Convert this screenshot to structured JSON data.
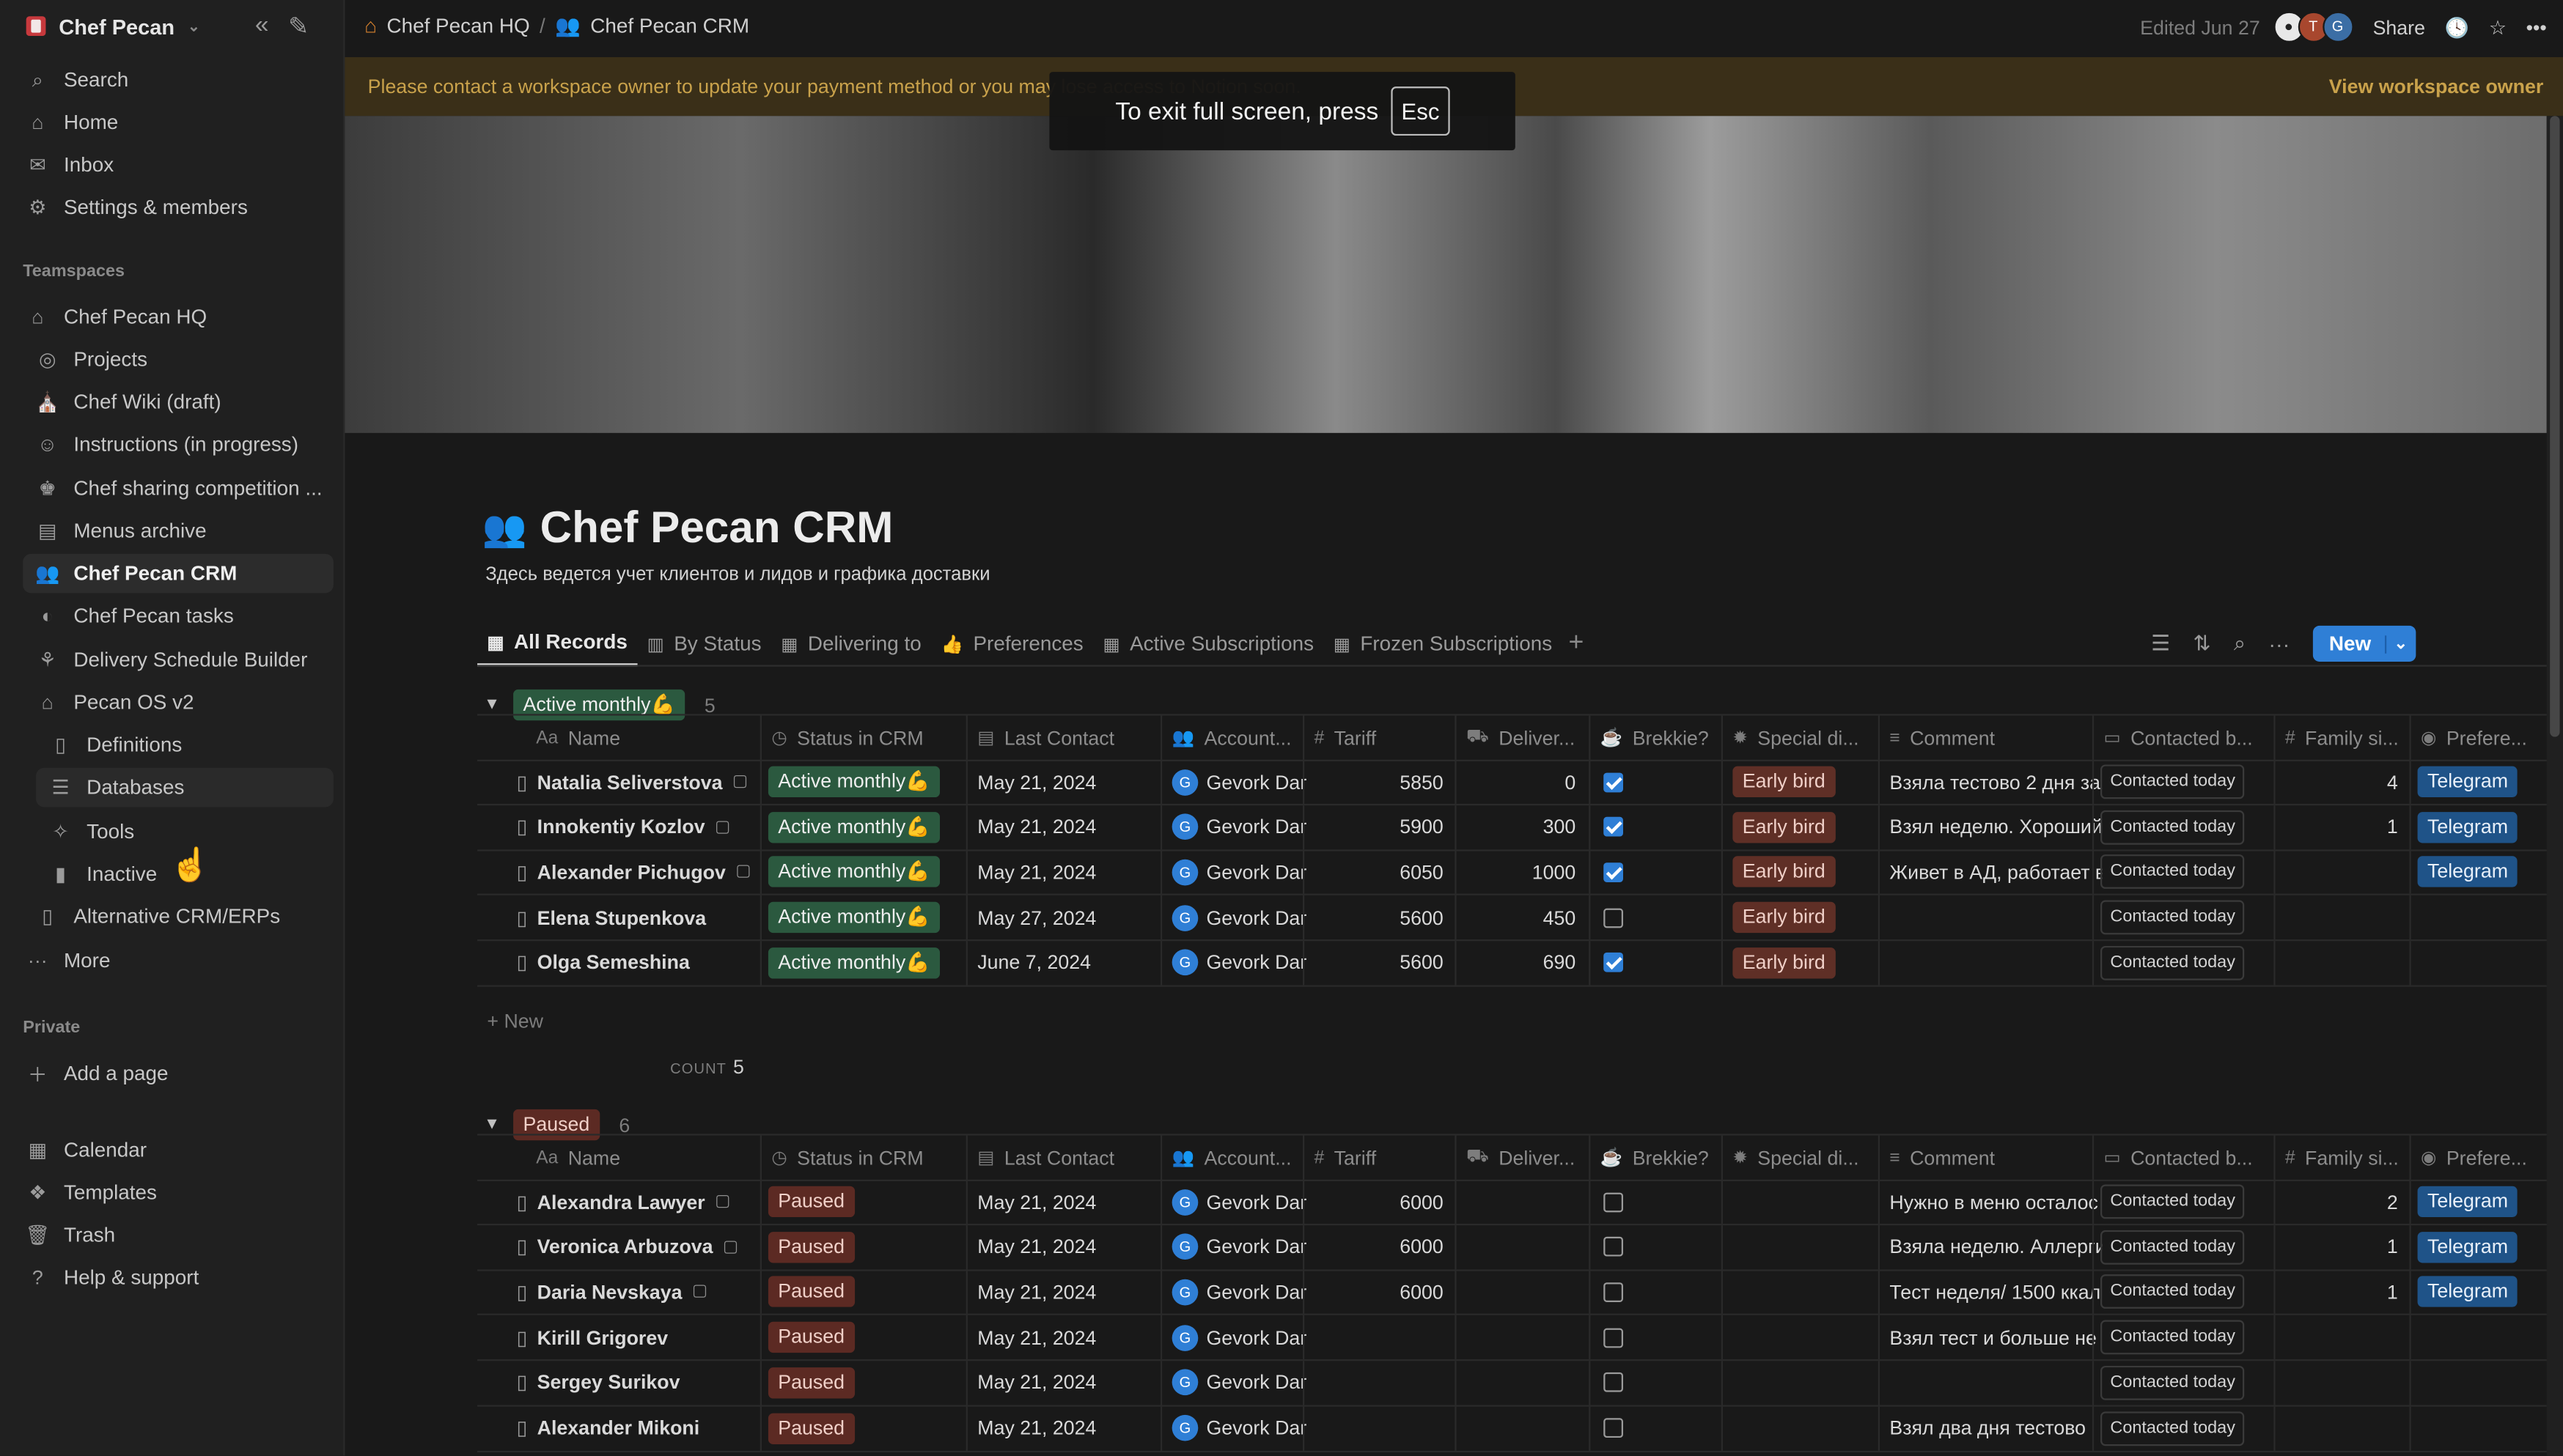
{
  "sidebar": {
    "workspace": "Chef Pecan",
    "top_items": [
      {
        "label": "Search",
        "icon": "search-icon"
      },
      {
        "label": "Home",
        "icon": "home-icon"
      },
      {
        "label": "Inbox",
        "icon": "inbox-icon"
      },
      {
        "label": "Settings & members",
        "icon": "gear-icon"
      }
    ],
    "teamspaces_label": "Teamspaces",
    "teamspace_items": [
      {
        "label": "Chef Pecan HQ",
        "icon": "home-icon"
      },
      {
        "label": "Projects",
        "icon": "target-icon"
      },
      {
        "label": "Chef Wiki (draft)",
        "icon": "wiki-icon"
      },
      {
        "label": "Instructions (in progress)",
        "icon": "emoji-icon"
      },
      {
        "label": "Chef sharing competition ...",
        "icon": "chef-icon"
      },
      {
        "label": "Menus archive",
        "icon": "archive-icon"
      },
      {
        "label": "Chef Pecan CRM",
        "icon": "people-icon"
      },
      {
        "label": "Chef Pecan tasks",
        "icon": "tasks-icon"
      },
      {
        "label": "Delivery Schedule Builder",
        "icon": "bike-icon"
      },
      {
        "label": "Pecan OS v2",
        "icon": "house-icon"
      },
      {
        "label": "Definitions",
        "icon": "doc-icon"
      },
      {
        "label": "Databases",
        "icon": "database-icon"
      },
      {
        "label": "Tools",
        "icon": "wrench-icon"
      },
      {
        "label": "Inactive",
        "icon": "trash-can-icon"
      },
      {
        "label": "Alternative CRM/ERPs",
        "icon": "doc-icon"
      },
      {
        "label": "More",
        "icon": "dots-icon"
      }
    ],
    "private_label": "Private",
    "add_page": "Add a page",
    "bottom_items": [
      {
        "label": "Calendar",
        "icon": "calendar-icon"
      },
      {
        "label": "Templates",
        "icon": "templates-icon"
      },
      {
        "label": "Trash",
        "icon": "trash-icon"
      },
      {
        "label": "Help & support",
        "icon": "help-icon"
      }
    ]
  },
  "topbar": {
    "breadcrumb_1": "Chef Pecan HQ",
    "breadcrumb_sep": "/",
    "breadcrumb_2": "Chef Pecan CRM",
    "edited": "Edited Jun 27",
    "share": "Share"
  },
  "banner": {
    "message": "Please contact a workspace owner to update your payment method or you may lose access to Notion soon.",
    "action": "View workspace owner"
  },
  "toast": {
    "text": "To exit full screen, press",
    "key": "Esc"
  },
  "page": {
    "title": "Chef Pecan CRM",
    "description": "Здесь ведется учет клиентов и лидов и графика доставки"
  },
  "tabs": [
    {
      "label": "All Records",
      "active": true
    },
    {
      "label": "By Status",
      "active": false
    },
    {
      "label": "Delivering to",
      "active": false
    },
    {
      "label": "Preferences",
      "active": false
    },
    {
      "label": "Active Subscriptions",
      "active": false
    },
    {
      "label": "Frozen Subscriptions",
      "active": false
    }
  ],
  "new_button": "New",
  "columns": {
    "name": "Name",
    "status": "Status in CRM",
    "last_contact": "Last Contact",
    "account": "Account...",
    "tariff": "Tariff",
    "deliver": "Deliver...",
    "brekkie": "Brekkie?",
    "special": "Special di...",
    "comment": "Comment",
    "contacted": "Contacted b...",
    "family": "Family si...",
    "preference": "Preferе..."
  },
  "groups": [
    {
      "label": "Active monthly💪",
      "count": "5",
      "color": "green",
      "rows": [
        {
          "name": "Natalia Seliverstova",
          "status": "Active monthly💪",
          "date": "May 21, 2024",
          "account": "Gevork Dar",
          "tariff": "5850",
          "deliver": "0",
          "brekkie": true,
          "special": "Early bird",
          "comment": "Взяла тестово 2 дня за",
          "contacted": "Contacted today",
          "family": "4",
          "pref": "Telegram"
        },
        {
          "name": "Innokentiy Kozlov",
          "status": "Active monthly💪",
          "date": "May 21, 2024",
          "account": "Gevork Dar",
          "tariff": "5900",
          "deliver": "300",
          "brekkie": true,
          "special": "Early bird",
          "comment": "Взял неделю. Хороший",
          "contacted": "Contacted today",
          "family": "1",
          "pref": "Telegram"
        },
        {
          "name": "Alexander Pichugov",
          "status": "Active monthly💪",
          "date": "May 21, 2024",
          "account": "Gevork Dar",
          "tariff": "6050",
          "deliver": "1000",
          "brekkie": true,
          "special": "Early bird",
          "comment": "Живет в АД, работает в",
          "contacted": "Contacted today",
          "family": "",
          "pref": "Telegram"
        },
        {
          "name": "Elena Stupenkova",
          "status": "Active monthly💪",
          "date": "May 27, 2024",
          "account": "Gevork Dar",
          "tariff": "5600",
          "deliver": "450",
          "brekkie": false,
          "special": "Early bird",
          "comment": "",
          "contacted": "Contacted today",
          "family": "",
          "pref": ""
        },
        {
          "name": "Olga Semeshina",
          "status": "Active monthly💪",
          "date": "June 7, 2024",
          "account": "Gevork Dar",
          "tariff": "5600",
          "deliver": "690",
          "brekkie": true,
          "special": "Early bird",
          "comment": "",
          "contacted": "Contacted today",
          "family": "",
          "pref": ""
        }
      ],
      "new_label": "New",
      "count_label": "COUNT",
      "count_value": "5"
    },
    {
      "label": "Paused",
      "count": "6",
      "color": "red",
      "rows": [
        {
          "name": "Alexandra Lawyer",
          "status": "Paused",
          "date": "May 21, 2024",
          "account": "Gevork Dar",
          "tariff": "6000",
          "deliver": "",
          "brekkie": false,
          "special": "",
          "comment": "Нужно в меню осталос",
          "contacted": "Contacted today",
          "family": "2",
          "pref": "Telegram"
        },
        {
          "name": "Veronica Arbuzova",
          "status": "Paused",
          "date": "May 21, 2024",
          "account": "Gevork Dar",
          "tariff": "6000",
          "deliver": "",
          "brekkie": false,
          "special": "",
          "comment": "Взяла неделю. Аллерги",
          "contacted": "Contacted today",
          "family": "1",
          "pref": "Telegram"
        },
        {
          "name": "Daria Nevskaya",
          "status": "Paused",
          "date": "May 21, 2024",
          "account": "Gevork Dar",
          "tariff": "6000",
          "deliver": "",
          "brekkie": false,
          "special": "",
          "comment": "Тест неделя/ 1500 ккал",
          "contacted": "Contacted today",
          "family": "1",
          "pref": "Telegram"
        },
        {
          "name": "Kirill Grigorev",
          "status": "Paused",
          "date": "May 21, 2024",
          "account": "Gevork Dar",
          "tariff": "",
          "deliver": "",
          "brekkie": false,
          "special": "",
          "comment": "Взял тест и больше не",
          "contacted": "Contacted today",
          "family": "",
          "pref": ""
        },
        {
          "name": "Sergey Surikov",
          "status": "Paused",
          "date": "May 21, 2024",
          "account": "Gevork Dar",
          "tariff": "",
          "deliver": "",
          "brekkie": false,
          "special": "",
          "comment": "",
          "contacted": "Contacted today",
          "family": "",
          "pref": ""
        },
        {
          "name": "Alexander Mikoni",
          "status": "Paused",
          "date": "May 21, 2024",
          "account": "Gevork Dar",
          "tariff": "",
          "deliver": "",
          "brekkie": false,
          "special": "",
          "comment": "Взял два дня тестово",
          "contacted": "Contacted today",
          "family": "",
          "pref": ""
        }
      ]
    }
  ]
}
